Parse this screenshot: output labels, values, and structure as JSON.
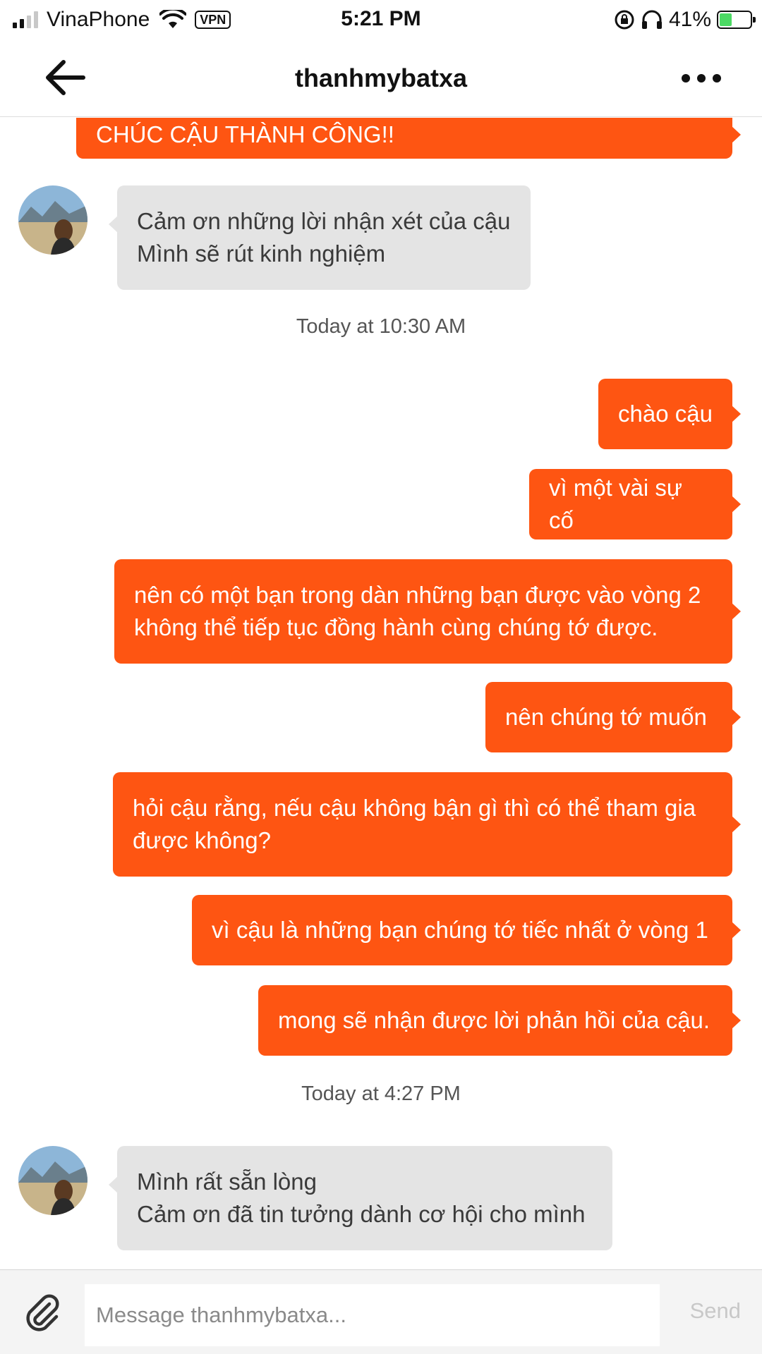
{
  "status_bar": {
    "carrier": "VinaPhone",
    "vpn": "VPN",
    "time": "5:21 PM",
    "battery": "41%",
    "signal_bars_filled": 2,
    "signal_bars_total": 4,
    "battery_level": 0.41
  },
  "header": {
    "title": "thanhmybatxa",
    "back_icon": "arrow-left-icon",
    "more_icon": "more-dots-icon"
  },
  "colors": {
    "outgoing_bubble": "#fe5512",
    "incoming_bubble": "#e4e4e4",
    "send_disabled": "#c8c8c8"
  },
  "messages": [
    {
      "direction": "out",
      "lines": [
        "CHÚC CẬU THÀNH CÔNG!!"
      ]
    },
    {
      "direction": "in",
      "lines": [
        "Cảm ơn những lời nhận xét của cậu",
        "Mình sẽ rút kinh nghiệm"
      ]
    },
    {
      "type": "timestamp",
      "text": "Today at 10:30 AM"
    },
    {
      "direction": "out",
      "lines": [
        "chào cậu"
      ]
    },
    {
      "direction": "out",
      "lines": [
        "vì một vài sự cố"
      ]
    },
    {
      "direction": "out",
      "lines": [
        "nên có một bạn trong dàn những bạn được vào vòng 2",
        "không thể tiếp tục đồng hành cùng chúng tớ được."
      ]
    },
    {
      "direction": "out",
      "lines": [
        "nên chúng tớ muốn"
      ]
    },
    {
      "direction": "out",
      "lines": [
        "hỏi cậu rằng, nếu cậu không bận gì thì có thể tham gia",
        "được không?"
      ]
    },
    {
      "direction": "out",
      "lines": [
        "vì cậu là những bạn chúng tớ tiếc nhất ở vòng 1"
      ]
    },
    {
      "direction": "out",
      "lines": [
        "mong sẽ nhận được lời phản hồi của cậu."
      ]
    },
    {
      "type": "timestamp",
      "text": "Today at 4:27 PM"
    },
    {
      "direction": "in",
      "lines": [
        "Mình rất sẵn lòng",
        "Cảm ơn đã tin tưởng dành cơ hội cho mình"
      ]
    }
  ],
  "composer": {
    "placeholder": "Message thanhmybatxa...",
    "send_label": "Send",
    "attach_icon": "paperclip-icon"
  }
}
